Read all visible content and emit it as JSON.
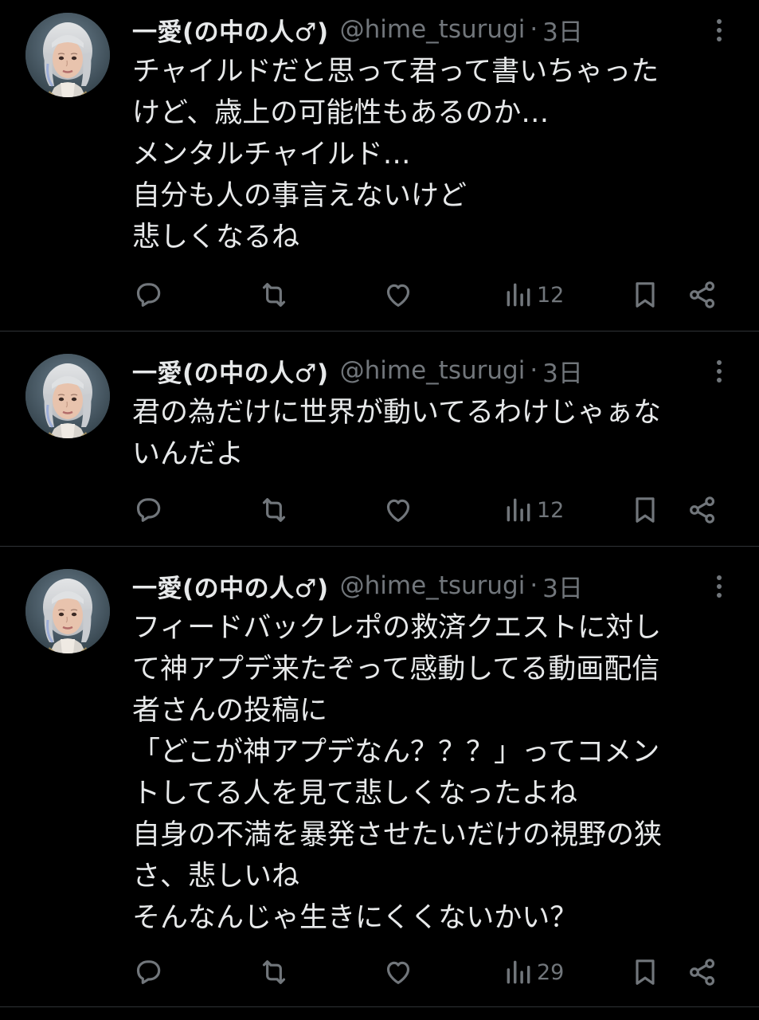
{
  "tweets": [
    {
      "author": {
        "name": "一愛(の中の人♂)",
        "handle": "@hime_tsurugi",
        "separator": "·",
        "time": "3日"
      },
      "lines": [
        "チャイルドだと思って君って書いちゃった",
        "けど、歳上の可能性もあるのか…",
        "メンタルチャイルド…",
        "自分も人の事言えないけど",
        "悲しくなるね"
      ],
      "views": "12"
    },
    {
      "author": {
        "name": "一愛(の中の人♂)",
        "handle": "@hime_tsurugi",
        "separator": "·",
        "time": "3日"
      },
      "lines": [
        "君の為だけに世界が動いてるわけじゃぁな",
        "いんだよ"
      ],
      "views": "12"
    },
    {
      "author": {
        "name": "一愛(の中の人♂)",
        "handle": "@hime_tsurugi",
        "separator": "·",
        "time": "3日"
      },
      "lines": [
        "フィードバックレポの救済クエストに対し",
        "て神アプデ来たぞって感動してる動画配信",
        "者さんの投稿に",
        "「どこが神アプデなん？？？」ってコメン",
        "トしてる人を見て悲しくなったよね",
        "自身の不満を暴発させたいだけの視野の狭",
        "さ、悲しいね",
        "そんなんじゃ生きにくくないかい？"
      ],
      "views": "29"
    }
  ],
  "icons": {
    "reply": "reply-icon",
    "retweet": "retweet-icon",
    "like": "heart-icon",
    "views": "views-chart-icon",
    "bookmark": "bookmark-icon",
    "share": "share-icon",
    "more": "more-dots-icon"
  },
  "colors": {
    "background": "#000000",
    "text": "#e7e9ea",
    "secondary": "#71767b",
    "divider": "#2f3336"
  }
}
